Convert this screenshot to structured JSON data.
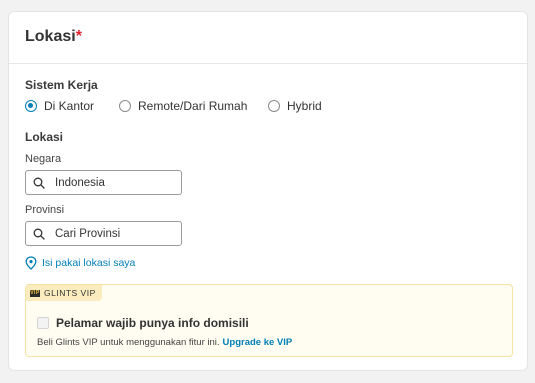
{
  "section": {
    "title": "Lokasi",
    "required_mark": "*"
  },
  "work_system": {
    "label": "Sistem Kerja",
    "options": [
      {
        "label": "Di Kantor",
        "selected": true
      },
      {
        "label": "Remote/Dari Rumah",
        "selected": false
      },
      {
        "label": "Hybrid",
        "selected": false
      }
    ]
  },
  "location": {
    "label": "Lokasi",
    "country": {
      "label": "Negara",
      "value": "Indonesia"
    },
    "province": {
      "label": "Provinsi",
      "placeholder": "Cari Provinsi"
    },
    "use_my_location": "Isi pakai lokasi saya"
  },
  "vip": {
    "badge_logo": "VIP",
    "badge": "GLINTS VIP",
    "checkbox_label": "Pelamar wajib punya info domisili",
    "note": "Beli Glints VIP untuk menggunakan fitur ini.",
    "upgrade_link": "Upgrade ke VIP"
  },
  "colors": {
    "accent": "#017eb7",
    "required": "#e0242f",
    "vip_bg": "#fffdf2",
    "vip_border": "#f5e3a3"
  }
}
